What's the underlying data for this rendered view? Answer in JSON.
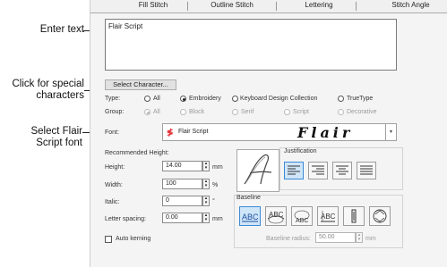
{
  "callouts": {
    "enter_text": "Enter text",
    "special_chars_line1": "Click for special",
    "special_chars_line2": "characters",
    "select_font_line1": "Select Flair",
    "select_font_line2": "Script font"
  },
  "tabs": [
    "Fill Stitch",
    "Outline Stitch",
    "Lettering",
    "Stitch Angle"
  ],
  "text_input": {
    "value": "Flair Script"
  },
  "select_character_button": "Select Character...",
  "type_row": {
    "label": "Type:",
    "options": [
      "All",
      "Embroidery",
      "Keyboard Design Collection",
      "TrueType"
    ],
    "selected": "Embroidery"
  },
  "group_row": {
    "label": "Group:",
    "options": [
      "All",
      "Block",
      "Serif",
      "Script",
      "Decorative"
    ]
  },
  "font": {
    "label": "Font:",
    "value": "Flair Script",
    "preview_sample": "Flair"
  },
  "recommended_height_label": "Recommended Height:",
  "fields": {
    "height": {
      "label": "Height:",
      "value": "14.00",
      "unit": "mm"
    },
    "width": {
      "label": "Width:",
      "value": "100",
      "unit": "%"
    },
    "italic": {
      "label": "Italic:",
      "value": "0",
      "unit": "°"
    },
    "letter_spacing": {
      "label": "Letter spacing:",
      "value": "0.00",
      "unit": "mm"
    }
  },
  "auto_kerning": {
    "label": "Auto kerning",
    "checked": false
  },
  "justification_label": "Justification",
  "baseline_label": "Baseline",
  "baseline_radius": {
    "label": "Baseline radius:",
    "value": "50.00",
    "unit": "mm"
  },
  "colors": {
    "selected_bg": "#cfe5f8",
    "selected_border": "#3c8ad6",
    "font_icon": "#e0333a"
  }
}
